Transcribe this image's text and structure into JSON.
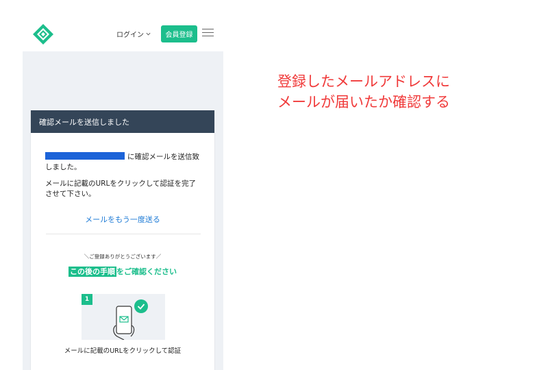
{
  "header": {
    "login_label": "ログイン",
    "signup_label": "会員登録"
  },
  "card": {
    "title": "確認メールを送信しました",
    "sent_message": "に確認メールを送信致しました。",
    "instruction": "メールに記載のURLをクリックして認証を完了させて下さい。",
    "resend_link": "メールをもう一度送る",
    "thanks": "＼ご登録ありがとうございます／",
    "steps_highlight": "この後の手順",
    "steps_rest": "をご確認ください",
    "step_number": "1",
    "step_caption": "メールに記載のURLをクリックして認証"
  },
  "annotation": {
    "line1": "登録したメールアドレスに",
    "line2": "メールが届いたか確認する"
  },
  "colors": {
    "brand_green": "#1cbe8c",
    "header_dark": "#344558",
    "link_blue": "#1e7bd6",
    "annotation_red": "#f03a3a",
    "redaction_blue": "#1c63d8"
  }
}
